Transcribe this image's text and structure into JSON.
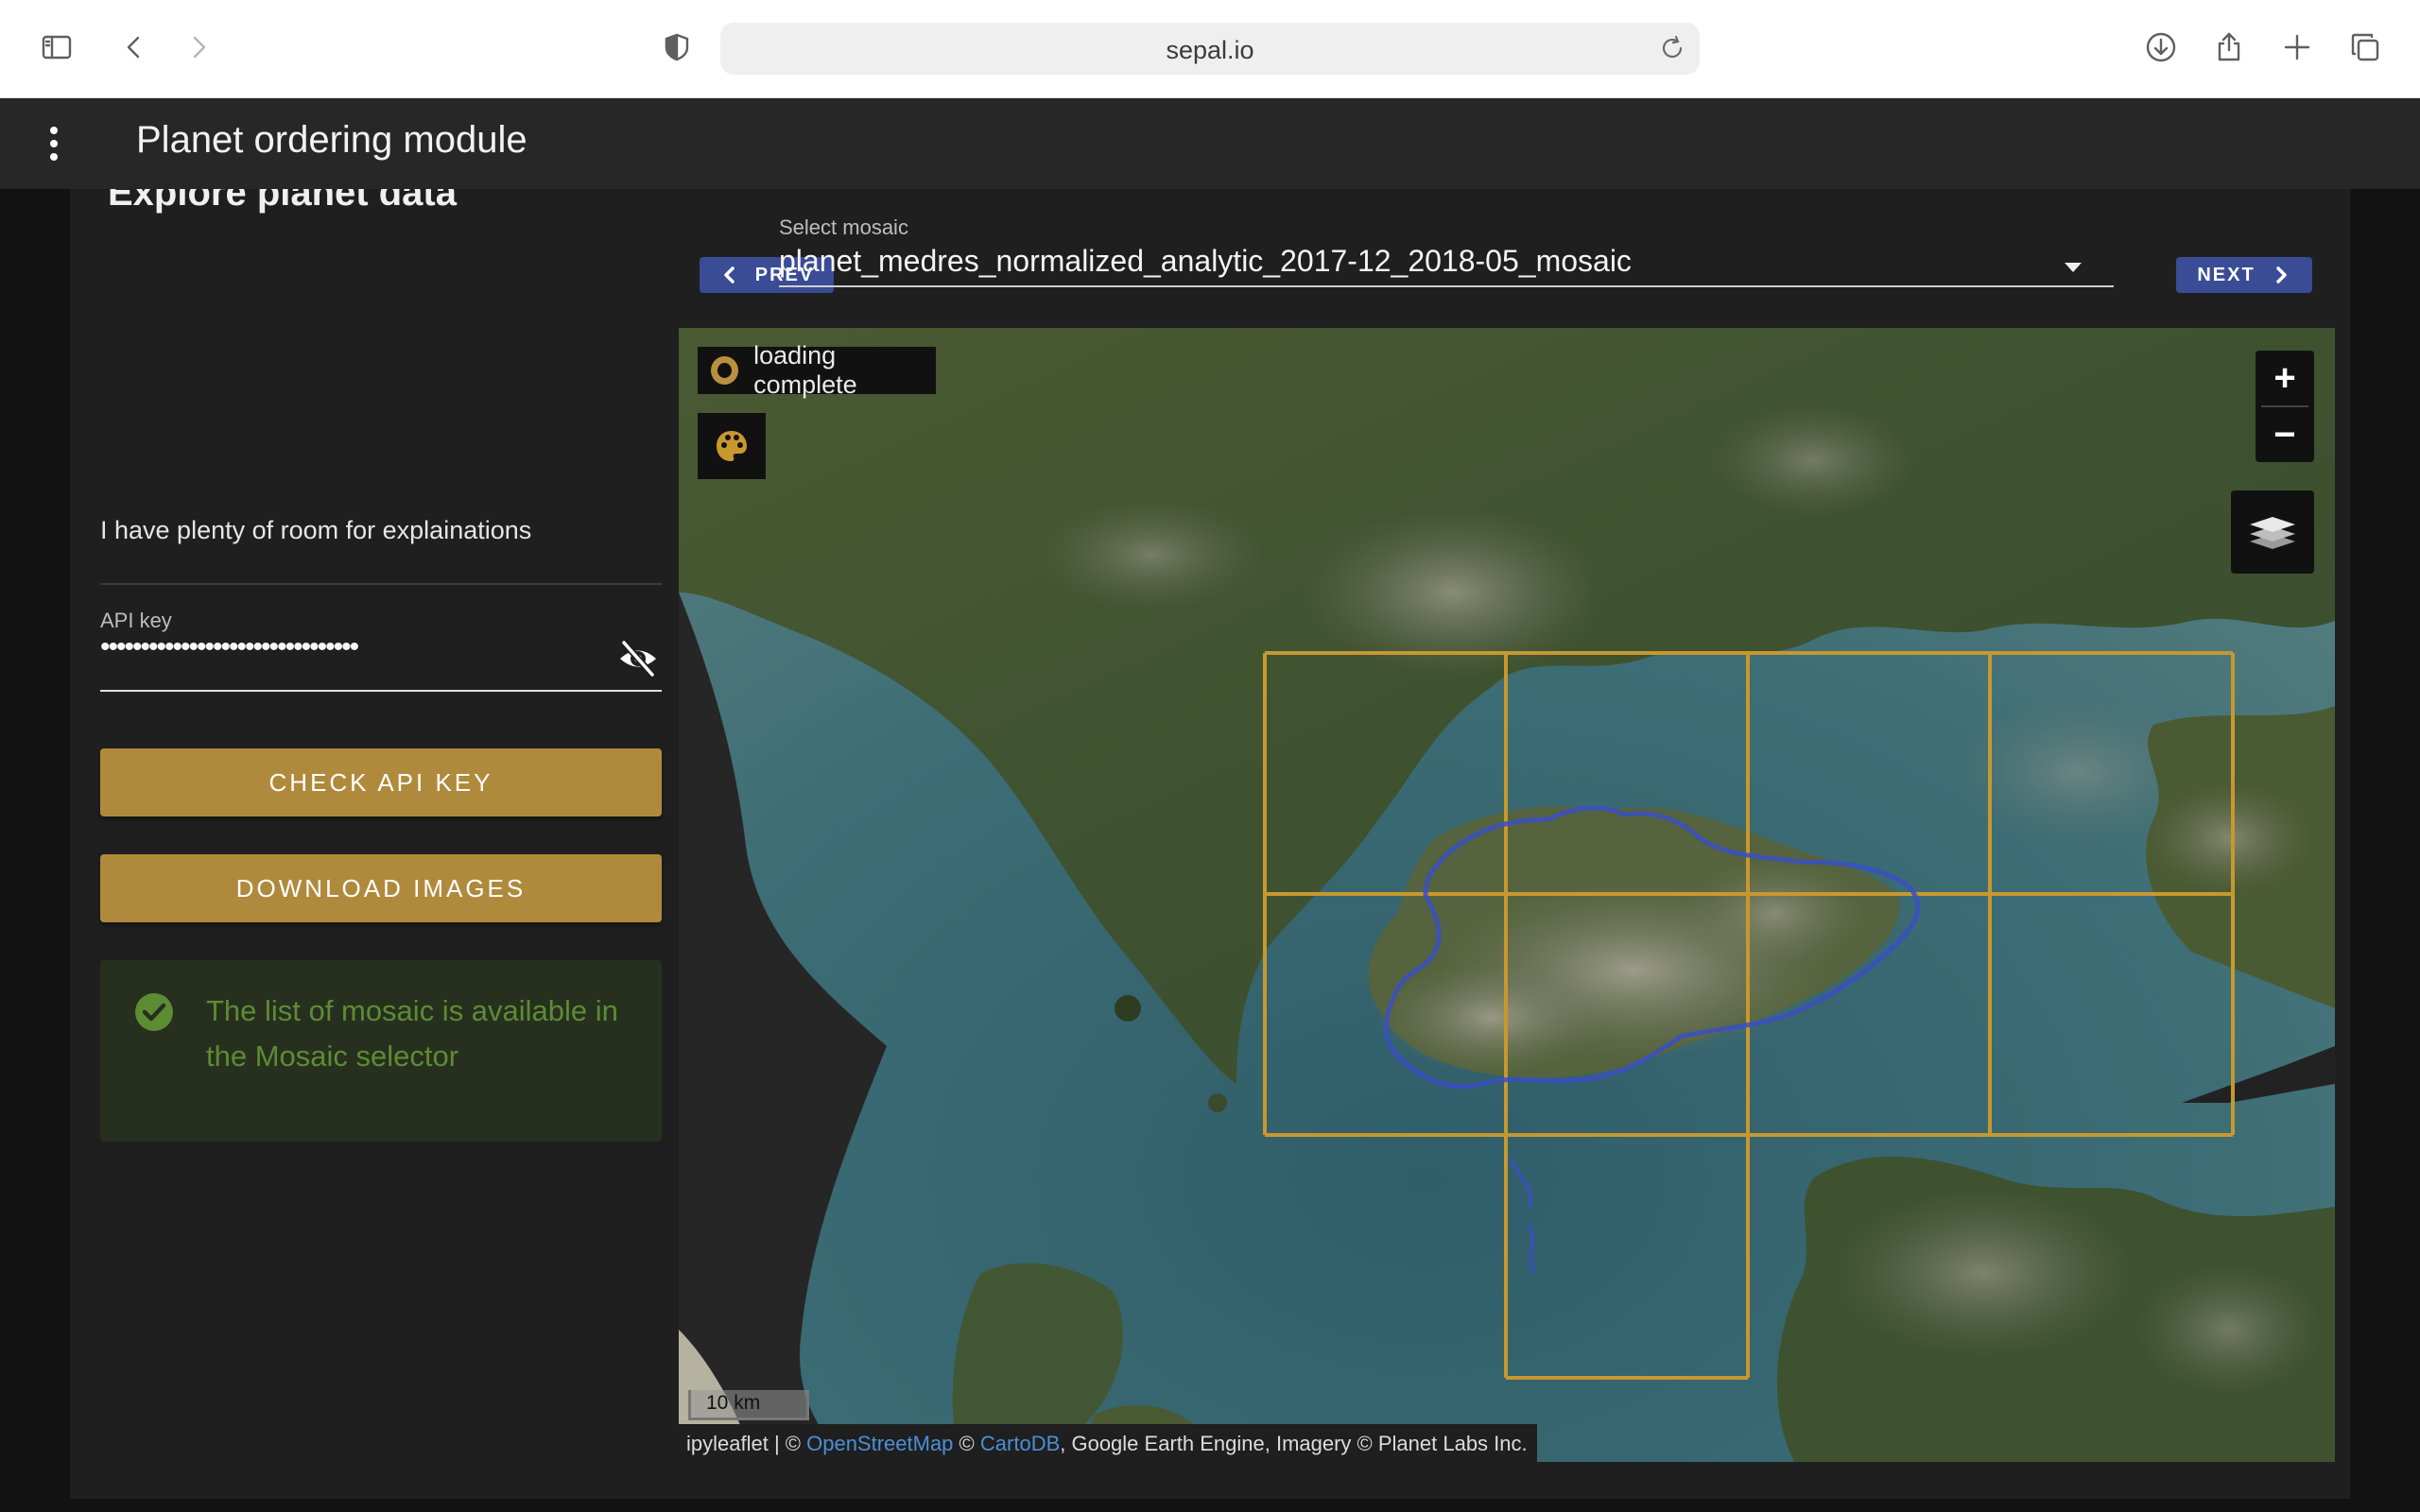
{
  "browser": {
    "url": "sepal.io",
    "icons": [
      "sidebar-icon",
      "back-icon",
      "forward-icon",
      "privacy-shield-icon",
      "reload-icon",
      "download-icon",
      "share-icon",
      "new-tab-icon",
      "tabs-overview-icon"
    ]
  },
  "app": {
    "title": "Planet ordering module",
    "menu_icon": "more-vert-icon"
  },
  "card": {
    "title": "Explore planet data"
  },
  "left_panel": {
    "description": "I have plenty of room for explainations",
    "api_key": {
      "label": "API key",
      "value": "••••••••••••••••••••••••••••••••",
      "toggle_icon": "eye-off-icon"
    },
    "check_button": "CHECK API KEY",
    "download_button": "DOWNLOAD IMAGES",
    "alert": {
      "icon": "check-circle-icon",
      "text": "The list of mosaic is available in the Mosaic selector"
    }
  },
  "mosaic_selector": {
    "prev_label": "PREV",
    "next_label": "NEXT",
    "label": "Select mosaic",
    "value": "planet_medres_normalized_analytic_2017-12_2018-05_mosaic"
  },
  "map": {
    "loading_text": "loading complete",
    "palette_icon": "palette-icon",
    "zoom_in": "+",
    "zoom_out": "−",
    "layers_icon": "layers-icon",
    "scale_label": "10 km",
    "attribution": {
      "prefix": "ipyleaflet | ©",
      "osm": "OpenStreetMap",
      "sep": "©",
      "carto": "CartoDB",
      "suffix": ", Google Earth Engine, Imagery © Planet Labs Inc."
    }
  },
  "colors": {
    "accent": "#b08a3c",
    "nav_button": "#3a4c95",
    "success_text": "#5c8c34",
    "grid_outline": "#c8982f",
    "boundary_outline": "#3b4fc4"
  }
}
